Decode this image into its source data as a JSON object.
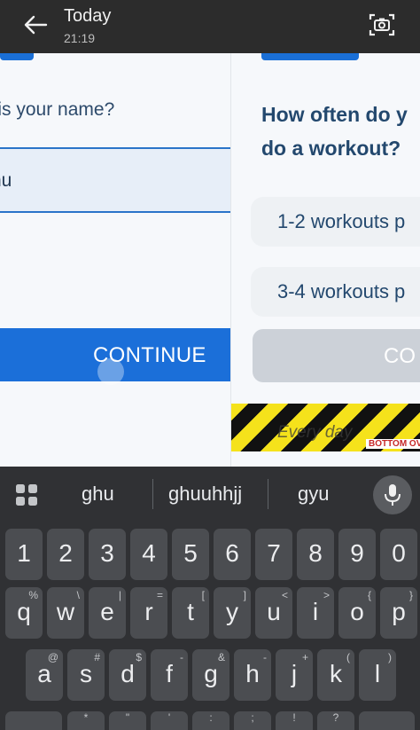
{
  "topbar": {
    "title": "Today",
    "time": "21:19"
  },
  "left_screen": {
    "question": "at is your name?",
    "name_value": "hu",
    "continue_label": "CONTINUE"
  },
  "right_screen": {
    "question_line1": "How often do y",
    "question_line2": "do a workout?",
    "options": [
      "1-2 workouts p",
      "3-4 workouts p"
    ],
    "continue_label": "CO",
    "banner_text": "Every day",
    "banner_bottom": "BOTTOM OVE"
  },
  "keyboard": {
    "suggestions": [
      "ghu",
      "ghuuhhjj",
      "gyu"
    ],
    "number_row": [
      "1",
      "2",
      "3",
      "4",
      "5",
      "6",
      "7",
      "8",
      "9",
      "0"
    ],
    "row1": [
      {
        "key": "q",
        "hint": "%"
      },
      {
        "key": "w",
        "hint": "\\"
      },
      {
        "key": "e",
        "hint": "|"
      },
      {
        "key": "r",
        "hint": "="
      },
      {
        "key": "t",
        "hint": "["
      },
      {
        "key": "y",
        "hint": "]"
      },
      {
        "key": "u",
        "hint": "<"
      },
      {
        "key": "i",
        "hint": ">"
      },
      {
        "key": "o",
        "hint": "{"
      },
      {
        "key": "p",
        "hint": "}"
      }
    ],
    "row2": [
      {
        "key": "a",
        "hint": "@"
      },
      {
        "key": "s",
        "hint": "#"
      },
      {
        "key": "d",
        "hint": "$"
      },
      {
        "key": "f",
        "hint": "-"
      },
      {
        "key": "g",
        "hint": "&"
      },
      {
        "key": "h",
        "hint": "-"
      },
      {
        "key": "j",
        "hint": "+"
      },
      {
        "key": "k",
        "hint": "("
      },
      {
        "key": "l",
        "hint": ")"
      }
    ],
    "row3_hints": [
      "*",
      "\"",
      "'",
      ":",
      ";",
      "!",
      "?"
    ]
  },
  "colors": {
    "accent_blue": "#1b6fd9",
    "heading_navy": "#23486e",
    "keyboard_bg": "#303134",
    "key_bg": "#4b4d51"
  }
}
